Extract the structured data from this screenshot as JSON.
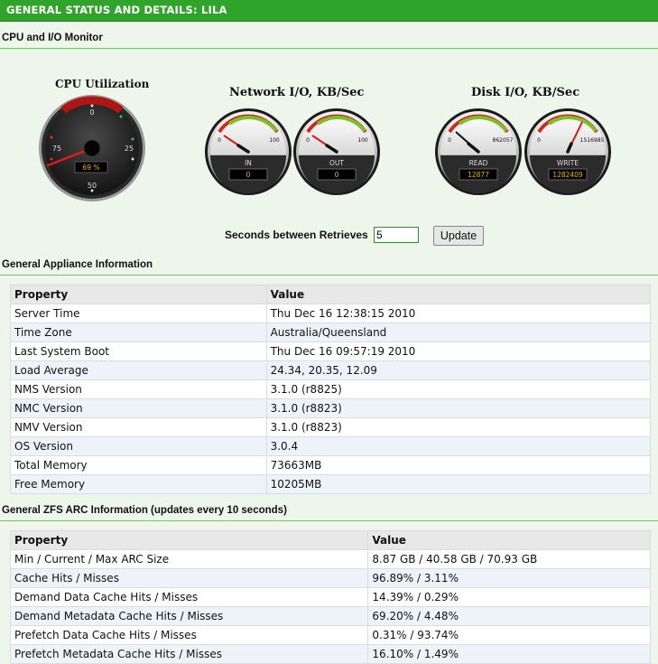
{
  "header": {
    "title": "GENERAL STATUS AND DETAILS: LILA"
  },
  "monitor": {
    "section_title": "CPU and I/O Monitor",
    "cpu": {
      "title": "CPU Utilization",
      "value_text": "69 %",
      "ticks": [
        "0",
        "25",
        "50",
        "75"
      ]
    },
    "network": {
      "title": "Network I/O, KB/Sec",
      "in": {
        "label": "IN",
        "value": "0",
        "min": "0",
        "max": "100"
      },
      "out": {
        "label": "OUT",
        "value": "0",
        "min": "0",
        "max": "100"
      }
    },
    "disk": {
      "title": "Disk I/O, KB/Sec",
      "read": {
        "label": "READ",
        "value": "12877",
        "min": "0",
        "max": "862057"
      },
      "write": {
        "label": "WRITE",
        "value": "1282409",
        "min": "0",
        "max": "1516985"
      }
    },
    "controls": {
      "label": "Seconds between Retrieves",
      "value": "5",
      "button": "Update"
    }
  },
  "appliance": {
    "section_title": "General Appliance Information",
    "headers": [
      "Property",
      "Value"
    ],
    "rows": [
      [
        "Server Time",
        "Thu Dec 16 12:38:15 2010"
      ],
      [
        "Time Zone",
        "Australia/Queensland"
      ],
      [
        "Last System Boot",
        "Thu Dec 16 09:57:19 2010"
      ],
      [
        "Load Average",
        "24.34, 20.35, 12.09"
      ],
      [
        "NMS Version",
        "3.1.0 (r8825)"
      ],
      [
        "NMC Version",
        "3.1.0 (r8823)"
      ],
      [
        "NMV Version",
        "3.1.0 (r8823)"
      ],
      [
        "OS Version",
        "3.0.4"
      ],
      [
        "Total Memory",
        "73663MB"
      ],
      [
        "Free Memory",
        "10205MB"
      ]
    ]
  },
  "arc": {
    "section_title": "General ZFS ARC Information (updates every 10 seconds)",
    "headers": [
      "Property",
      "Value"
    ],
    "rows": [
      [
        "Min / Current / Max ARC Size",
        "8.87 GB / 40.58 GB / 70.93 GB"
      ],
      [
        "Cache Hits / Misses",
        "96.89% / 3.11%"
      ],
      [
        "Demand Data Cache Hits / Misses",
        "14.39% / 0.29%"
      ],
      [
        "Demand Metadata Cache Hits / Misses",
        "69.20% / 4.48%"
      ],
      [
        "Prefetch Data Cache Hits / Misses",
        "0.31% / 93.74%"
      ],
      [
        "Prefetch Metadata Cache Hits / Misses",
        "16.10% / 1.49%"
      ]
    ]
  }
}
